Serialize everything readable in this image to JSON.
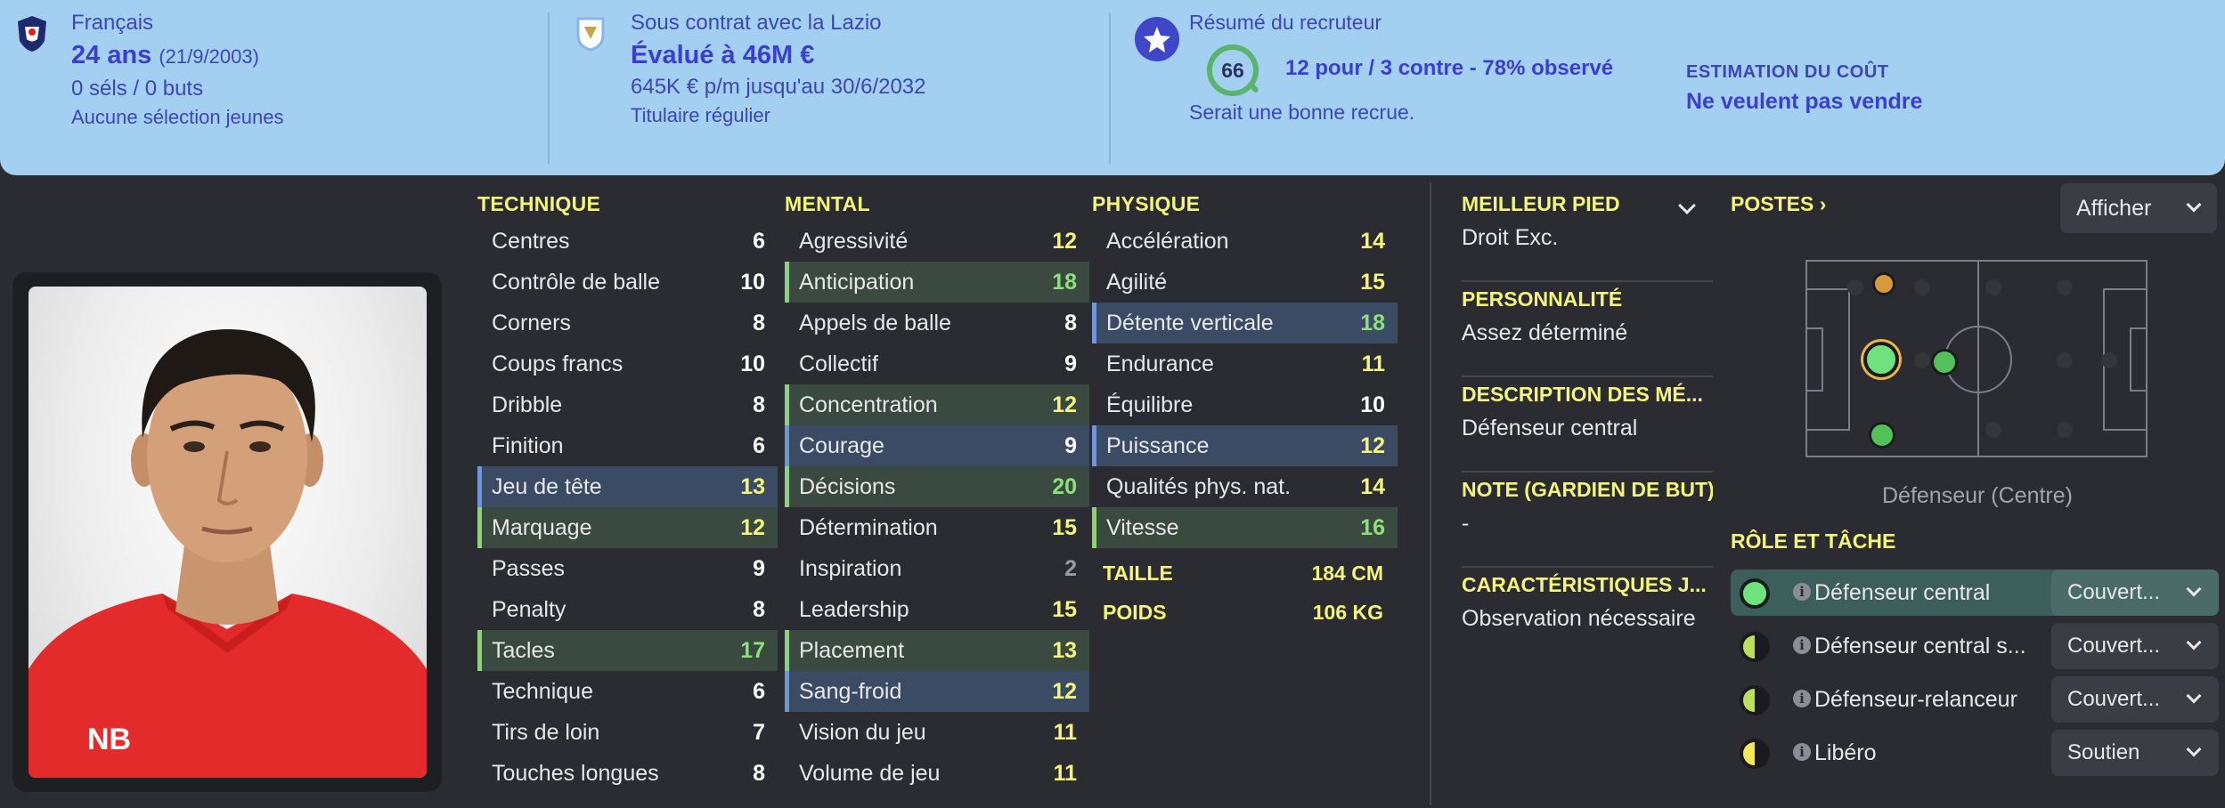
{
  "banner": {
    "nationality": "Français",
    "age": "24 ans",
    "dob": "(21/9/2003)",
    "caps": "0 séls / 0 buts",
    "youth": "Aucune sélection jeunes",
    "contract": "Sous contrat avec la Lazio",
    "value": "Évalué à 46M €",
    "wage": "645K € p/m jusqu'au 30/6/2032",
    "status": "Titulaire régulier",
    "scout_title": "Résumé du recruteur",
    "scout_rating": "66",
    "scout_count": "12 pour / 3 contre - 78% observé",
    "scout_note": "Serait une bonne recrue.",
    "cost_label": "ESTIMATION DU COÛT",
    "cost_value": "Ne veulent pas vendre"
  },
  "attributes": {
    "technique": {
      "title": "TECHNIQUE",
      "rows": [
        {
          "name": "Centres",
          "value": "6",
          "hl": ""
        },
        {
          "name": "Contrôle de balle",
          "value": "10",
          "hl": ""
        },
        {
          "name": "Corners",
          "value": "8",
          "hl": ""
        },
        {
          "name": "Coups francs",
          "value": "10",
          "hl": ""
        },
        {
          "name": "Dribble",
          "value": "8",
          "hl": ""
        },
        {
          "name": "Finition",
          "value": "6",
          "hl": ""
        },
        {
          "name": "Jeu de tête",
          "value": "13",
          "hl": "b"
        },
        {
          "name": "Marquage",
          "value": "12",
          "hl": "g"
        },
        {
          "name": "Passes",
          "value": "9",
          "hl": ""
        },
        {
          "name": "Penalty",
          "value": "8",
          "hl": ""
        },
        {
          "name": "Tacles",
          "value": "17",
          "hl": "g"
        },
        {
          "name": "Technique",
          "value": "6",
          "hl": ""
        },
        {
          "name": "Tirs de loin",
          "value": "7",
          "hl": ""
        },
        {
          "name": "Touches longues",
          "value": "8",
          "hl": ""
        }
      ]
    },
    "mental": {
      "title": "MENTAL",
      "rows": [
        {
          "name": "Agressivité",
          "value": "12",
          "hl": ""
        },
        {
          "name": "Anticipation",
          "value": "18",
          "hl": "g"
        },
        {
          "name": "Appels de balle",
          "value": "8",
          "hl": ""
        },
        {
          "name": "Collectif",
          "value": "9",
          "hl": ""
        },
        {
          "name": "Concentration",
          "value": "12",
          "hl": "g"
        },
        {
          "name": "Courage",
          "value": "9",
          "hl": "b"
        },
        {
          "name": "Décisions",
          "value": "20",
          "hl": "g"
        },
        {
          "name": "Détermination",
          "value": "15",
          "hl": ""
        },
        {
          "name": "Inspiration",
          "value": "2",
          "hl": ""
        },
        {
          "name": "Leadership",
          "value": "15",
          "hl": ""
        },
        {
          "name": "Placement",
          "value": "13",
          "hl": "g"
        },
        {
          "name": "Sang-froid",
          "value": "12",
          "hl": "b"
        },
        {
          "name": "Vision du jeu",
          "value": "11",
          "hl": ""
        },
        {
          "name": "Volume de jeu",
          "value": "11",
          "hl": ""
        }
      ]
    },
    "physique": {
      "title": "PHYSIQUE",
      "rows": [
        {
          "name": "Accélération",
          "value": "14",
          "hl": ""
        },
        {
          "name": "Agilité",
          "value": "15",
          "hl": ""
        },
        {
          "name": "Détente verticale",
          "value": "18",
          "hl": "b"
        },
        {
          "name": "Endurance",
          "value": "11",
          "hl": ""
        },
        {
          "name": "Équilibre",
          "value": "10",
          "hl": ""
        },
        {
          "name": "Puissance",
          "value": "12",
          "hl": "b"
        },
        {
          "name": "Qualités phys. nat.",
          "value": "14",
          "hl": ""
        },
        {
          "name": "Vitesse",
          "value": "16",
          "hl": "g"
        }
      ],
      "height_label": "TAILLE",
      "height_value": "184 CM",
      "weight_label": "POIDS",
      "weight_value": "106 KG"
    }
  },
  "info": {
    "foot_label": "MEILLEUR PIED",
    "foot_value": "Droit Exc.",
    "personality_label": "PERSONNALITÉ",
    "personality_value": "Assez déterminé",
    "description_label": "DESCRIPTION DES MÉ...",
    "description_value": "Défenseur central",
    "gk_label": "NOTE (GARDIEN DE BUT)",
    "gk_value": "-",
    "traits_label": "CARACTÉRISTIQUES J...",
    "traits_value": "Observation nécessaire"
  },
  "positions": {
    "title": "POSTES",
    "show_label": "Afficher",
    "caption": "Défenseur (Centre)"
  },
  "roles": {
    "title": "RÔLE ET TÂCHE",
    "items": [
      {
        "name": "Défenseur central",
        "duty": "Couvert...",
        "dot": "full"
      },
      {
        "name": "Défenseur central s...",
        "duty": "Couvert...",
        "dot": "half-green"
      },
      {
        "name": "Défenseur-relanceur",
        "duty": "Couvert...",
        "dot": "half-green"
      },
      {
        "name": "Libéro",
        "duty": "Soutien",
        "dot": "half-yellow"
      }
    ]
  },
  "colors": {
    "banner_bg": "#a3cff1",
    "attr_heading": "#f4f57a",
    "value_high": "#8de07a",
    "value_mid": "#f4f57a",
    "value_low": "#ffffff",
    "value_very_low": "#9a9aa0",
    "highlight_green": "#3a4a40",
    "highlight_blue": "#3a4b63"
  }
}
